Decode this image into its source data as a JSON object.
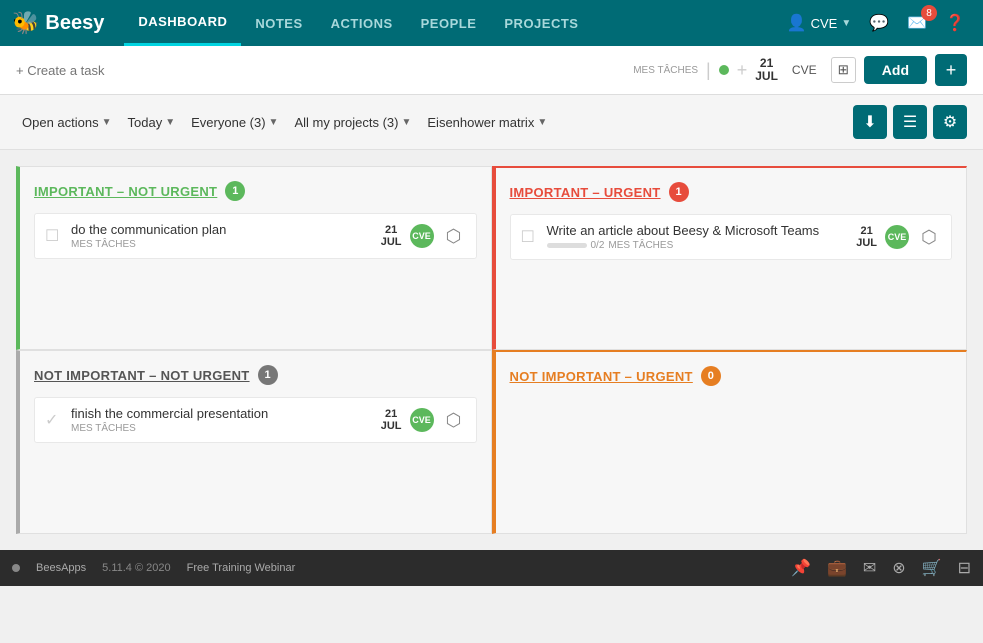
{
  "app": {
    "name": "Beesy",
    "logo_icon": "🐝"
  },
  "nav": {
    "links": [
      {
        "label": "DASHBOARD",
        "active": true
      },
      {
        "label": "NOTES",
        "active": false
      },
      {
        "label": "ACTIONS",
        "active": false
      },
      {
        "label": "PEOPLE",
        "active": false
      },
      {
        "label": "PROJECTS",
        "active": false
      }
    ],
    "user": "CVE",
    "notification_count": "8"
  },
  "toolbar": {
    "create_task_placeholder": "+ Create a task",
    "mes_taches": "MES TÂCHES",
    "date_day": "21",
    "date_month": "JUL",
    "user_label": "CVE",
    "add_label": "Add",
    "plus_label": "+"
  },
  "filters": {
    "open_actions": "Open actions",
    "today": "Today",
    "everyone": "Everyone (3)",
    "all_my_projects": "All my projects (3)",
    "eisenhower": "Eisenhower matrix"
  },
  "quadrants": [
    {
      "id": "important-not-urgent",
      "title": "IMPORTANT – NOT URGENT",
      "color": "green",
      "count": "1",
      "tasks": [
        {
          "title": "do the communication plan",
          "sub": "MES TÂCHES",
          "date_day": "21",
          "date_month": "JUL",
          "avatar": "CVE",
          "progress": null
        }
      ]
    },
    {
      "id": "important-urgent",
      "title": "IMPORTANT – URGENT",
      "color": "red",
      "count": "1",
      "tasks": [
        {
          "title": "Write an article about Beesy & Microsoft Teams",
          "sub": "MES TÂCHES",
          "date_day": "21",
          "date_month": "JUL",
          "avatar": "CVE",
          "progress": "0/2"
        }
      ]
    },
    {
      "id": "not-important-not-urgent",
      "title": "NOT IMPORTANT – NOT URGENT",
      "color": "dark",
      "count": "1",
      "tasks": [
        {
          "title": "finish the commercial presentation",
          "sub": "MES TÂCHES",
          "date_day": "21",
          "date_month": "JUL",
          "avatar": "CVE",
          "progress": null
        }
      ]
    },
    {
      "id": "not-important-urgent",
      "title": "NOT IMPORTANT – URGENT",
      "color": "orange",
      "count": "0",
      "tasks": []
    }
  ],
  "bottom": {
    "brand": "BeesApps",
    "version": "5.11.4 © 2020",
    "training": "Free Training Webinar"
  }
}
